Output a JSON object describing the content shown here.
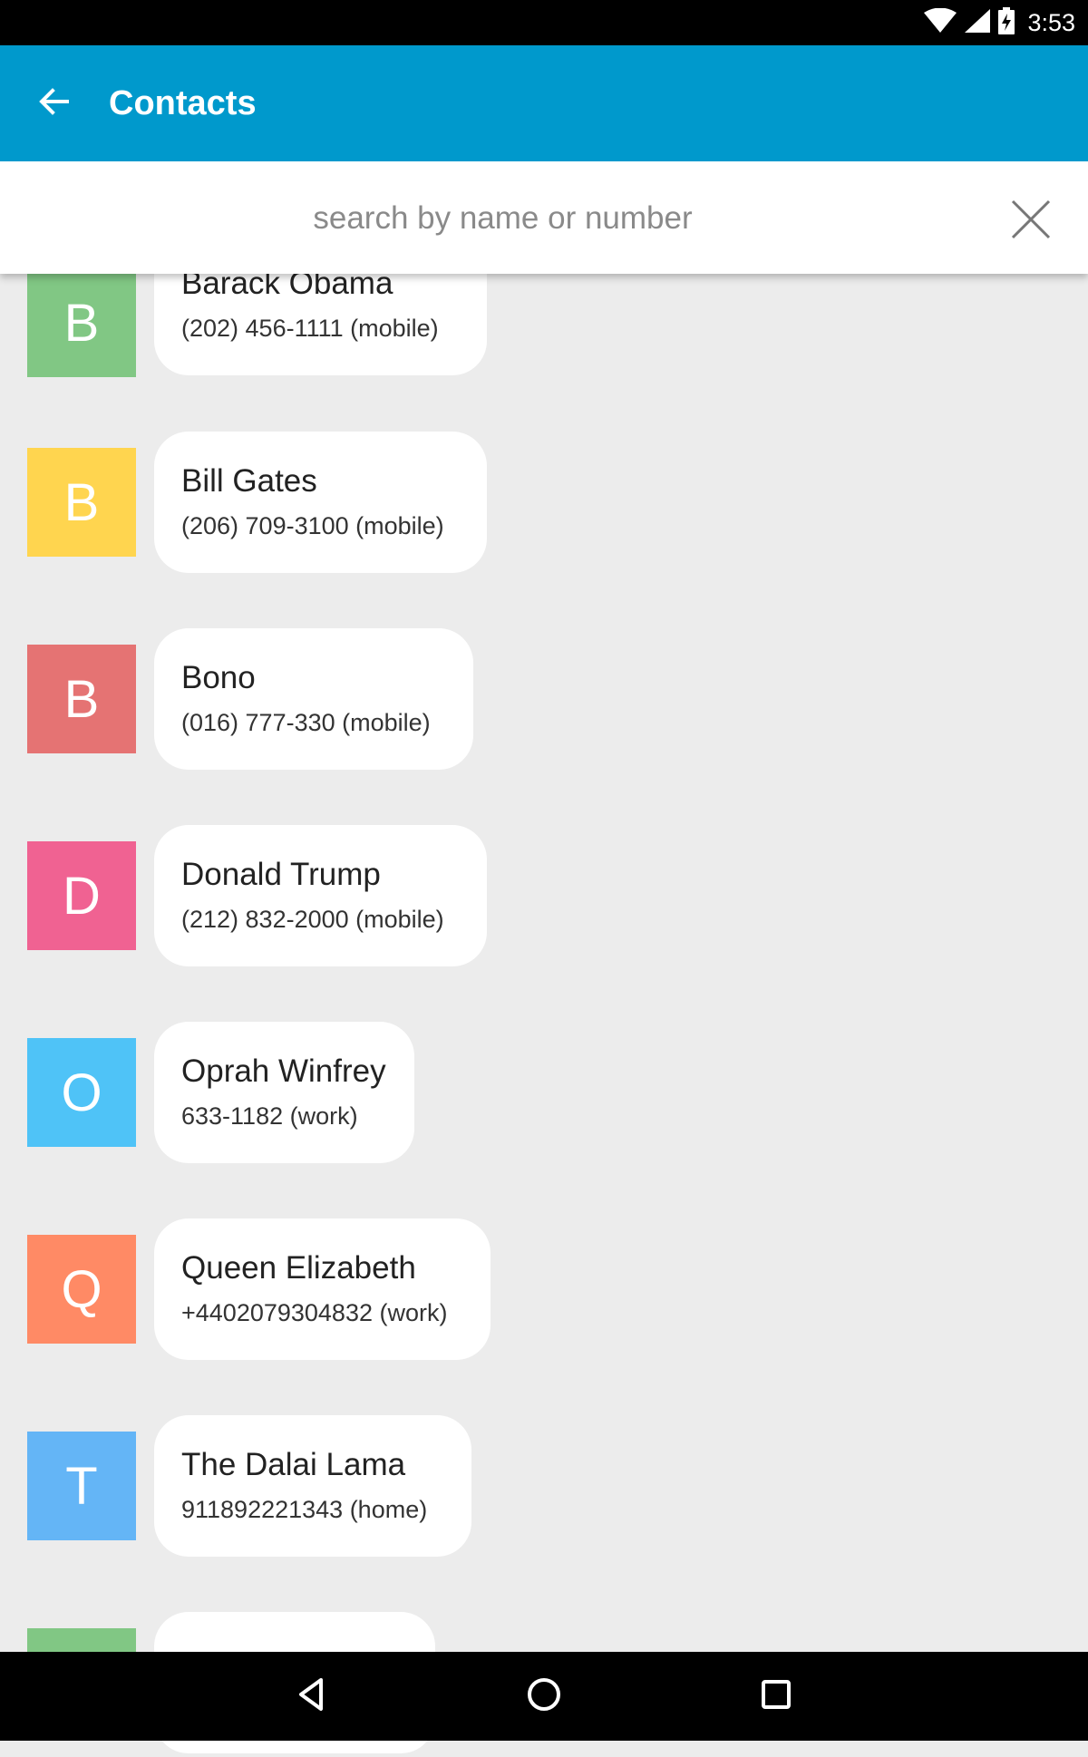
{
  "status_bar": {
    "time": "3:53",
    "icons": [
      "wifi-icon",
      "cell-signal-icon",
      "battery-charging-icon"
    ]
  },
  "app_bar": {
    "title": "Contacts",
    "back_icon": "arrow-back-icon",
    "color": "#0099cc"
  },
  "search": {
    "placeholder": "search by name or number",
    "value": "",
    "clear_icon": "close-icon"
  },
  "contacts": [
    {
      "initial": "B",
      "name": "Barack Obama",
      "number": "(202) 456-1111 (mobile)",
      "color": "#81c784"
    },
    {
      "initial": "B",
      "name": "Bill Gates",
      "number": "(206) 709-3100 (mobile)",
      "color": "#ffd54f"
    },
    {
      "initial": "B",
      "name": "Bono",
      "number": "(016) 777-330 (mobile)",
      "color": "#e57373"
    },
    {
      "initial": "D",
      "name": "Donald Trump",
      "number": "(212) 832-2000 (mobile)",
      "color": "#f06292"
    },
    {
      "initial": "O",
      "name": "Oprah Winfrey",
      "number": "633-1182 (work)",
      "color": "#4fc3f7"
    },
    {
      "initial": "Q",
      "name": "Queen Elizabeth",
      "number": "+4402079304832 (work)",
      "color": "#ff8a65"
    },
    {
      "initial": "T",
      "name": "The Dalai Lama",
      "number": "911892221343 (home)",
      "color": "#64b5f6"
    },
    {
      "initial": "",
      "name": "",
      "number": "",
      "color": "#81c784"
    }
  ],
  "nav_bar": {
    "icons": [
      "back-triangle-icon",
      "home-circle-icon",
      "recents-square-icon"
    ]
  }
}
